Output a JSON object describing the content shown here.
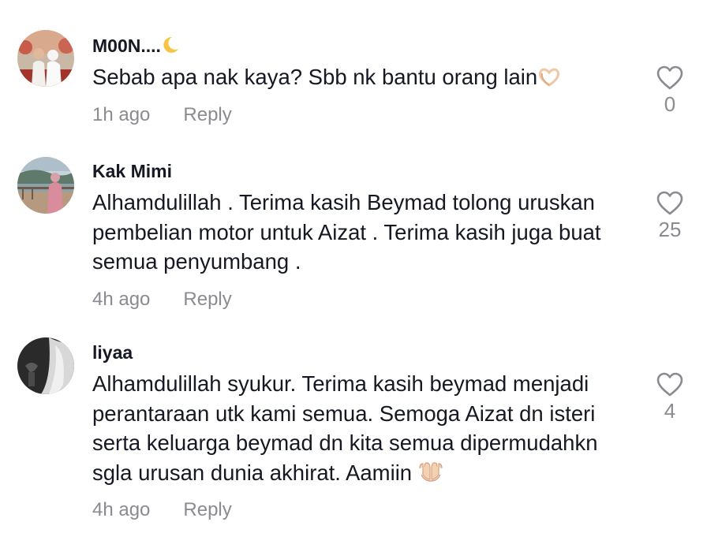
{
  "comments": [
    {
      "username": "M00N....",
      "username_emoji": "crescent-moon",
      "text": "Sebab apa nak kaya? Sbb nk bantu orang lain",
      "text_emoji": "heart-hands",
      "time": "1h ago",
      "reply_label": "Reply",
      "like_count": "0"
    },
    {
      "username": "Kak Mimi",
      "text": "Alhamdulillah . Terima kasih Beymad tolong uruskan pembelian motor untuk Aizat . Terima kasih juga buat semua penyumbang .",
      "time": "4h ago",
      "reply_label": "Reply",
      "like_count": "25"
    },
    {
      "username": "liyaa",
      "text": "Alhamdulillah syukur. Terima kasih beymad menjadi perantaraan utk kami semua. Semoga Aizat dn isteri serta keluarga beymad dn kita semua dipermudahkn sgla urusan dunia akhirat. Aamiin",
      "text_emoji": "palms-up-together",
      "time": "4h ago",
      "reply_label": "Reply",
      "like_count": "4"
    }
  ],
  "icons": {
    "like": "heart-outline-icon"
  },
  "colors": {
    "text": "#161823",
    "secondary": "#8a8b91",
    "background": "#ffffff"
  }
}
